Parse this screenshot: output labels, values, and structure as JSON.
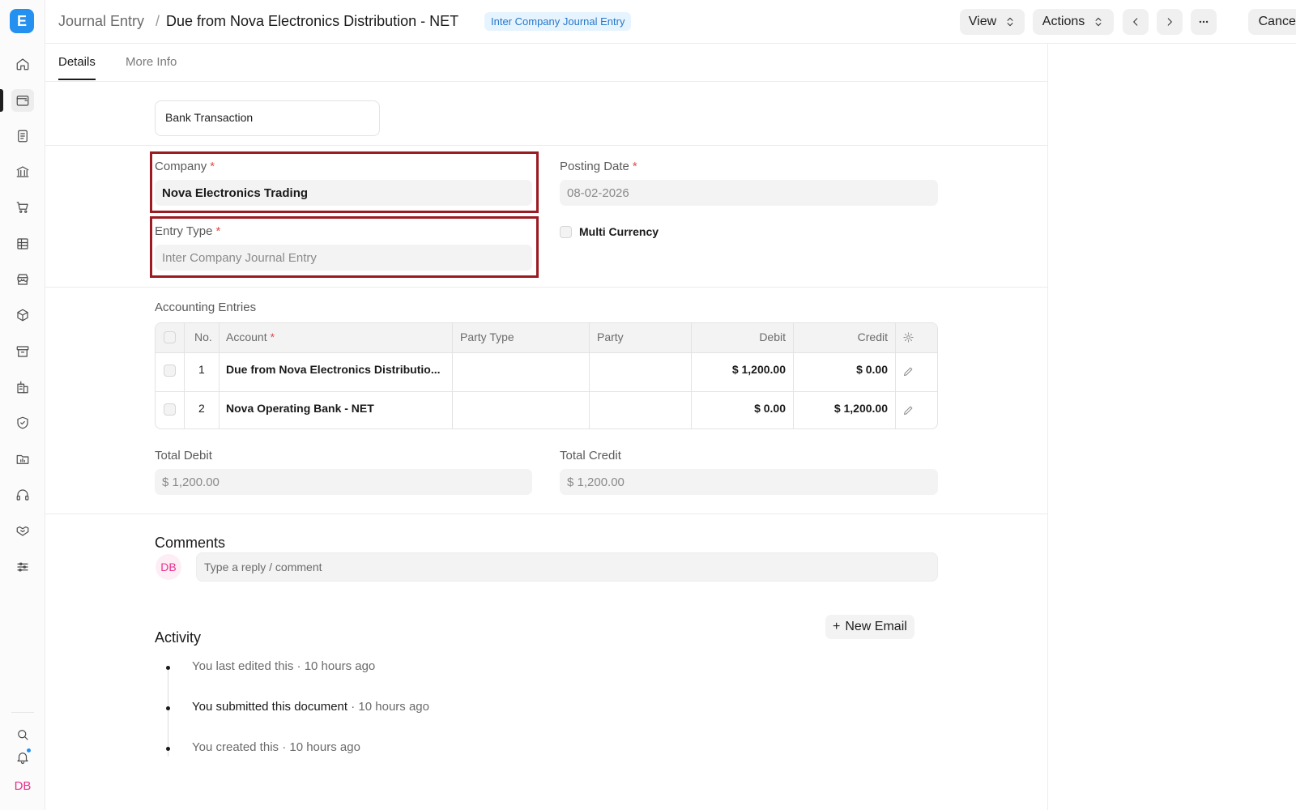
{
  "app": {
    "logo_letter": "E"
  },
  "sidebar": {
    "icons": [
      "home-icon",
      "wallet-icon",
      "document-icon",
      "bank-icon",
      "cart-icon",
      "table-icon",
      "store-icon",
      "box-icon",
      "archive-icon",
      "building-icon",
      "shield-icon",
      "folder-chart-icon",
      "headset-icon",
      "handshake-icon",
      "sliders-icon"
    ],
    "avatar": "DB"
  },
  "header": {
    "breadcrumb_root": "Journal Entry",
    "separator": "/",
    "title": "Due from Nova Electronics Distribution - NET",
    "status": "Inter Company Journal Entry",
    "view_label": "View",
    "actions_label": "Actions",
    "cancel_label": "Cancel"
  },
  "tabs": [
    {
      "label": "Details",
      "active": true
    },
    {
      "label": "More Info",
      "active": false
    }
  ],
  "form": {
    "bank_transaction": "Bank Transaction",
    "company_label": "Company",
    "company_value": "Nova Electronics Trading",
    "posting_date_label": "Posting Date",
    "posting_date_value": "08-02-2026",
    "entry_type_label": "Entry Type",
    "entry_type_value": "Inter Company Journal Entry",
    "multi_currency_label": "Multi Currency",
    "required_mark": "*"
  },
  "accounting": {
    "title": "Accounting Entries",
    "columns": {
      "no": "No.",
      "account": "Account",
      "party_type": "Party Type",
      "party": "Party",
      "debit": "Debit",
      "credit": "Credit"
    },
    "rows": [
      {
        "no": "1",
        "account": "Due from Nova Electronics Distributio...",
        "party_type": "",
        "party": "",
        "debit": "$ 1,200.00",
        "credit": "$ 0.00"
      },
      {
        "no": "2",
        "account": "Nova Operating Bank - NET",
        "party_type": "",
        "party": "",
        "debit": "$ 0.00",
        "credit": "$ 1,200.00"
      }
    ]
  },
  "totals": {
    "debit_label": "Total Debit",
    "debit_value": "$ 1,200.00",
    "credit_label": "Total Credit",
    "credit_value": "$ 1,200.00"
  },
  "comments": {
    "title": "Comments",
    "avatar": "DB",
    "placeholder": "Type a reply / comment"
  },
  "activity": {
    "title": "Activity",
    "new_email_label": "New Email",
    "items": [
      {
        "text": "You last edited this",
        "time": " · 10 hours ago"
      },
      {
        "text": "You submitted this document",
        "time": " · 10 hours ago"
      },
      {
        "text": "You created this",
        "time": " · 10 hours ago"
      }
    ]
  },
  "colors": {
    "accent": "#2490ef",
    "highlight": "#9b1b22",
    "avatar": "#e8308c"
  }
}
